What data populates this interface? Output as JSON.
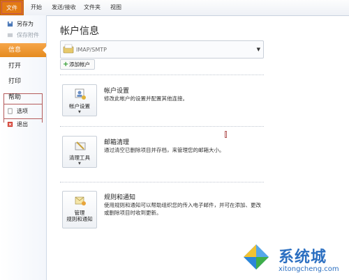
{
  "ribbon": {
    "tabs": [
      "文件",
      "开始",
      "发送/接收",
      "文件夹",
      "视图"
    ]
  },
  "nav": {
    "save_as": "另存为",
    "save_attachments": "保存附件",
    "info": "信息",
    "open": "打开",
    "print": "打印",
    "help": "帮助",
    "options": "选项",
    "exit": "退出"
  },
  "main": {
    "title": "帐户信息",
    "account_label": "IMAP/SMTP",
    "add_account": "添加帐户",
    "sections": [
      {
        "button": "帐户设置",
        "heading": "帐户设置",
        "desc": "修改此帐户的设置并配置其他连接。"
      },
      {
        "button": "清理工具",
        "heading": "邮箱清理",
        "desc": "通过清空已删除项目并存档，来管理您的邮箱大小。"
      },
      {
        "button": "管理\n规则和通知",
        "heading": "规则和通知",
        "desc": "使用规则和通知可以帮助组织您的传入电子邮件，并可在添加、更改或删除项目时收到更新。"
      }
    ]
  },
  "watermark": {
    "cn": "系统城",
    "en": "xitongcheng.com"
  },
  "colors": {
    "accent": "#e58b1f",
    "watermark": "#2b6fc1"
  }
}
